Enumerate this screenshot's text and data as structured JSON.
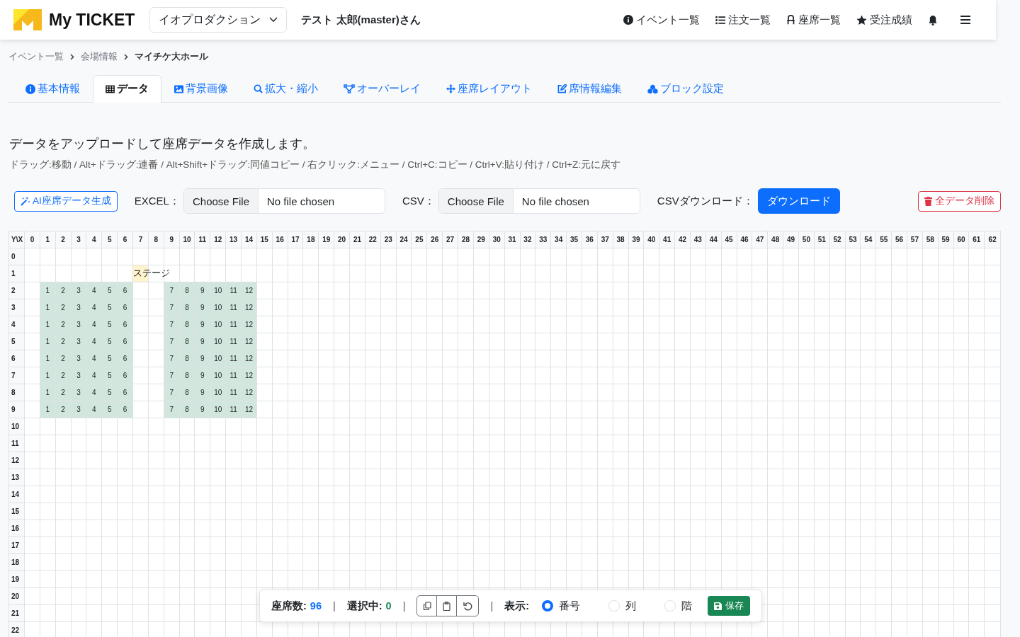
{
  "header": {
    "brand": "My TICKET",
    "company_select": "イオプロダクション",
    "user": "テスト 太郎(master)さん",
    "nav": [
      {
        "label": "イベント一覧"
      },
      {
        "label": "注文一覧"
      },
      {
        "label": "座席一覧"
      },
      {
        "label": "受注成績"
      }
    ]
  },
  "breadcrumb": [
    {
      "label": "イベント一覧",
      "current": false
    },
    {
      "label": "会場情報",
      "current": false
    },
    {
      "label": "マイチケ大ホール",
      "current": true
    }
  ],
  "tabs": [
    {
      "label": "基本情報",
      "selected": false
    },
    {
      "label": "データ",
      "selected": true
    },
    {
      "label": "背景画像",
      "selected": false
    },
    {
      "label": "拡大・縮小",
      "selected": false
    },
    {
      "label": "オーバーレイ",
      "selected": false
    },
    {
      "label": "座席レイアウト",
      "selected": false
    },
    {
      "label": "席情報編集",
      "selected": false
    },
    {
      "label": "ブロック設定",
      "selected": false
    }
  ],
  "heading": "データをアップロードして座席データを作成します。",
  "hint": "ドラッグ:移動 / Alt+ドラッグ:連番 / Alt+Shift+ドラッグ:同値コピー / 右クリック:メニュー / Ctrl+C:コピー / Ctrl+V:貼り付け / Ctrl+Z:元に戻す",
  "toolbar": {
    "ai_button": "AI座席データ生成",
    "uploads": [
      {
        "label": "EXCEL：",
        "button": "Choose File",
        "status": "No file chosen"
      },
      {
        "label": "CSV：",
        "button": "Choose File",
        "status": "No file chosen"
      }
    ],
    "download_label": "CSVダウンロード：",
    "download_button": "ダウンロード",
    "delete_button": "全データ削除"
  },
  "grid": {
    "corner": "Y\\X",
    "columns": [
      "0",
      "1",
      "2",
      "3",
      "4",
      "5",
      "6",
      "7",
      "8",
      "9",
      "10",
      "11",
      "12",
      "13",
      "14",
      "15",
      "16",
      "17",
      "18",
      "19",
      "20",
      "21",
      "22",
      "23",
      "24",
      "25",
      "26",
      "27",
      "28",
      "29",
      "30",
      "31",
      "32",
      "33",
      "34",
      "35",
      "36",
      "37",
      "38",
      "39",
      "40",
      "41",
      "42",
      "43",
      "44",
      "45",
      "46",
      "47",
      "48",
      "49",
      "50",
      "51",
      "52",
      "53",
      "54",
      "55",
      "56",
      "57",
      "58",
      "59",
      "60",
      "61",
      "62"
    ],
    "rows": [
      {
        "label": "0",
        "cells": []
      },
      {
        "label": "1",
        "cells": [
          "",
          "",
          "",
          "",
          "",
          "",
          "",
          {
            "text": "ステージ",
            "kind": "stage"
          }
        ]
      },
      {
        "label": "2",
        "cells": [
          "",
          {
            "text": "1",
            "kind": "seat"
          },
          {
            "text": "2",
            "kind": "seat"
          },
          {
            "text": "3",
            "kind": "seat"
          },
          {
            "text": "4",
            "kind": "seat"
          },
          {
            "text": "5",
            "kind": "seat"
          },
          {
            "text": "6",
            "kind": "seat"
          },
          "",
          "",
          {
            "text": "7",
            "kind": "seat"
          },
          {
            "text": "8",
            "kind": "seat"
          },
          {
            "text": "9",
            "kind": "seat"
          },
          {
            "text": "10",
            "kind": "seat"
          },
          {
            "text": "11",
            "kind": "seat"
          },
          {
            "text": "12",
            "kind": "seat"
          }
        ]
      },
      {
        "label": "3",
        "cells": [
          "",
          {
            "text": "1",
            "kind": "seat"
          },
          {
            "text": "2",
            "kind": "seat"
          },
          {
            "text": "3",
            "kind": "seat"
          },
          {
            "text": "4",
            "kind": "seat"
          },
          {
            "text": "5",
            "kind": "seat"
          },
          {
            "text": "6",
            "kind": "seat"
          },
          "",
          "",
          {
            "text": "7",
            "kind": "seat"
          },
          {
            "text": "8",
            "kind": "seat"
          },
          {
            "text": "9",
            "kind": "seat"
          },
          {
            "text": "10",
            "kind": "seat"
          },
          {
            "text": "11",
            "kind": "seat"
          },
          {
            "text": "12",
            "kind": "seat"
          }
        ]
      },
      {
        "label": "4",
        "cells": [
          "",
          {
            "text": "1",
            "kind": "seat"
          },
          {
            "text": "2",
            "kind": "seat"
          },
          {
            "text": "3",
            "kind": "seat"
          },
          {
            "text": "4",
            "kind": "seat"
          },
          {
            "text": "5",
            "kind": "seat"
          },
          {
            "text": "6",
            "kind": "seat"
          },
          "",
          "",
          {
            "text": "7",
            "kind": "seat"
          },
          {
            "text": "8",
            "kind": "seat"
          },
          {
            "text": "9",
            "kind": "seat"
          },
          {
            "text": "10",
            "kind": "seat"
          },
          {
            "text": "11",
            "kind": "seat"
          },
          {
            "text": "12",
            "kind": "seat"
          }
        ]
      },
      {
        "label": "5",
        "cells": [
          "",
          {
            "text": "1",
            "kind": "seat"
          },
          {
            "text": "2",
            "kind": "seat"
          },
          {
            "text": "3",
            "kind": "seat"
          },
          {
            "text": "4",
            "kind": "seat"
          },
          {
            "text": "5",
            "kind": "seat"
          },
          {
            "text": "6",
            "kind": "seat"
          },
          "",
          "",
          {
            "text": "7",
            "kind": "seat"
          },
          {
            "text": "8",
            "kind": "seat"
          },
          {
            "text": "9",
            "kind": "seat"
          },
          {
            "text": "10",
            "kind": "seat"
          },
          {
            "text": "11",
            "kind": "seat"
          },
          {
            "text": "12",
            "kind": "seat"
          }
        ]
      },
      {
        "label": "6",
        "cells": [
          "",
          {
            "text": "1",
            "kind": "seat"
          },
          {
            "text": "2",
            "kind": "seat"
          },
          {
            "text": "3",
            "kind": "seat"
          },
          {
            "text": "4",
            "kind": "seat"
          },
          {
            "text": "5",
            "kind": "seat"
          },
          {
            "text": "6",
            "kind": "seat"
          },
          "",
          "",
          {
            "text": "7",
            "kind": "seat"
          },
          {
            "text": "8",
            "kind": "seat"
          },
          {
            "text": "9",
            "kind": "seat"
          },
          {
            "text": "10",
            "kind": "seat"
          },
          {
            "text": "11",
            "kind": "seat"
          },
          {
            "text": "12",
            "kind": "seat"
          }
        ]
      },
      {
        "label": "7",
        "cells": [
          "",
          {
            "text": "1",
            "kind": "seat"
          },
          {
            "text": "2",
            "kind": "seat"
          },
          {
            "text": "3",
            "kind": "seat"
          },
          {
            "text": "4",
            "kind": "seat"
          },
          {
            "text": "5",
            "kind": "seat"
          },
          {
            "text": "6",
            "kind": "seat"
          },
          "",
          "",
          {
            "text": "7",
            "kind": "seat"
          },
          {
            "text": "8",
            "kind": "seat"
          },
          {
            "text": "9",
            "kind": "seat"
          },
          {
            "text": "10",
            "kind": "seat"
          },
          {
            "text": "11",
            "kind": "seat"
          },
          {
            "text": "12",
            "kind": "seat"
          }
        ]
      },
      {
        "label": "8",
        "cells": [
          "",
          {
            "text": "1",
            "kind": "seat"
          },
          {
            "text": "2",
            "kind": "seat"
          },
          {
            "text": "3",
            "kind": "seat"
          },
          {
            "text": "4",
            "kind": "seat"
          },
          {
            "text": "5",
            "kind": "seat"
          },
          {
            "text": "6",
            "kind": "seat"
          },
          "",
          "",
          {
            "text": "7",
            "kind": "seat"
          },
          {
            "text": "8",
            "kind": "seat"
          },
          {
            "text": "9",
            "kind": "seat"
          },
          {
            "text": "10",
            "kind": "seat"
          },
          {
            "text": "11",
            "kind": "seat"
          },
          {
            "text": "12",
            "kind": "seat"
          }
        ]
      },
      {
        "label": "9",
        "cells": [
          "",
          {
            "text": "1",
            "kind": "seat"
          },
          {
            "text": "2",
            "kind": "seat"
          },
          {
            "text": "3",
            "kind": "seat"
          },
          {
            "text": "4",
            "kind": "seat"
          },
          {
            "text": "5",
            "kind": "seat"
          },
          {
            "text": "6",
            "kind": "seat"
          },
          "",
          "",
          {
            "text": "7",
            "kind": "seat"
          },
          {
            "text": "8",
            "kind": "seat"
          },
          {
            "text": "9",
            "kind": "seat"
          },
          {
            "text": "10",
            "kind": "seat"
          },
          {
            "text": "11",
            "kind": "seat"
          },
          {
            "text": "12",
            "kind": "seat"
          }
        ]
      },
      {
        "label": "10",
        "cells": []
      },
      {
        "label": "11",
        "cells": []
      },
      {
        "label": "12",
        "cells": []
      },
      {
        "label": "13",
        "cells": []
      },
      {
        "label": "14",
        "cells": []
      },
      {
        "label": "15",
        "cells": []
      },
      {
        "label": "16",
        "cells": []
      },
      {
        "label": "17",
        "cells": []
      },
      {
        "label": "18",
        "cells": []
      },
      {
        "label": "19",
        "cells": []
      },
      {
        "label": "20",
        "cells": []
      },
      {
        "label": "21",
        "cells": []
      },
      {
        "label": "22",
        "cells": []
      }
    ]
  },
  "status_bar": {
    "seat_count_label": "座席数:",
    "seat_count": "96",
    "selected_label": "選択中:",
    "selected_count": "0",
    "separator": "|",
    "display_label": "表示:",
    "display_options": [
      {
        "label": "番号",
        "selected": true
      },
      {
        "label": "列",
        "selected": false
      },
      {
        "label": "階",
        "selected": false
      }
    ],
    "save_button": "保存"
  }
}
